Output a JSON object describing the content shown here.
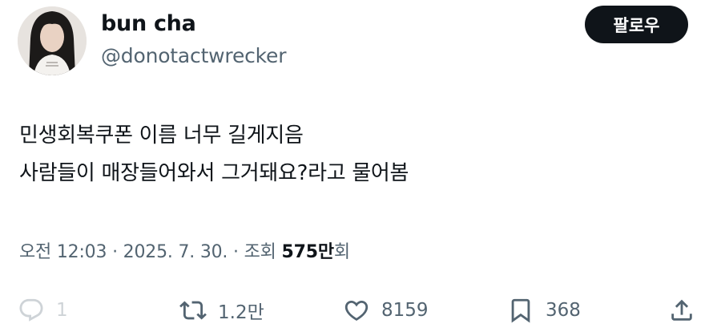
{
  "author": {
    "name": "bun cha",
    "handle": "@donotactwrecker",
    "follow_label": "팔로우"
  },
  "tweet": {
    "lines": [
      "민생회복쿠폰 이름 너무 길게지음",
      "사람들이 매장들어와서 그거돼요?라고 물어봄"
    ]
  },
  "meta": {
    "time": "오전 12:03",
    "separator": "·",
    "date": "2025. 7. 30.",
    "views_label": "조회",
    "views_count": "575만",
    "views_suffix": "회"
  },
  "actions": {
    "reply": {
      "icon": "reply-icon",
      "count": "1"
    },
    "retweet": {
      "icon": "retweet-icon",
      "count": "1.2만"
    },
    "like": {
      "icon": "heart-icon",
      "count": "8159"
    },
    "bookmark": {
      "icon": "bookmark-icon",
      "count": "368"
    },
    "share": {
      "icon": "share-icon"
    }
  },
  "colors": {
    "text": "#0f1419",
    "secondary": "#536471",
    "follow_bg": "#0f1419",
    "follow_text": "#ffffff"
  }
}
